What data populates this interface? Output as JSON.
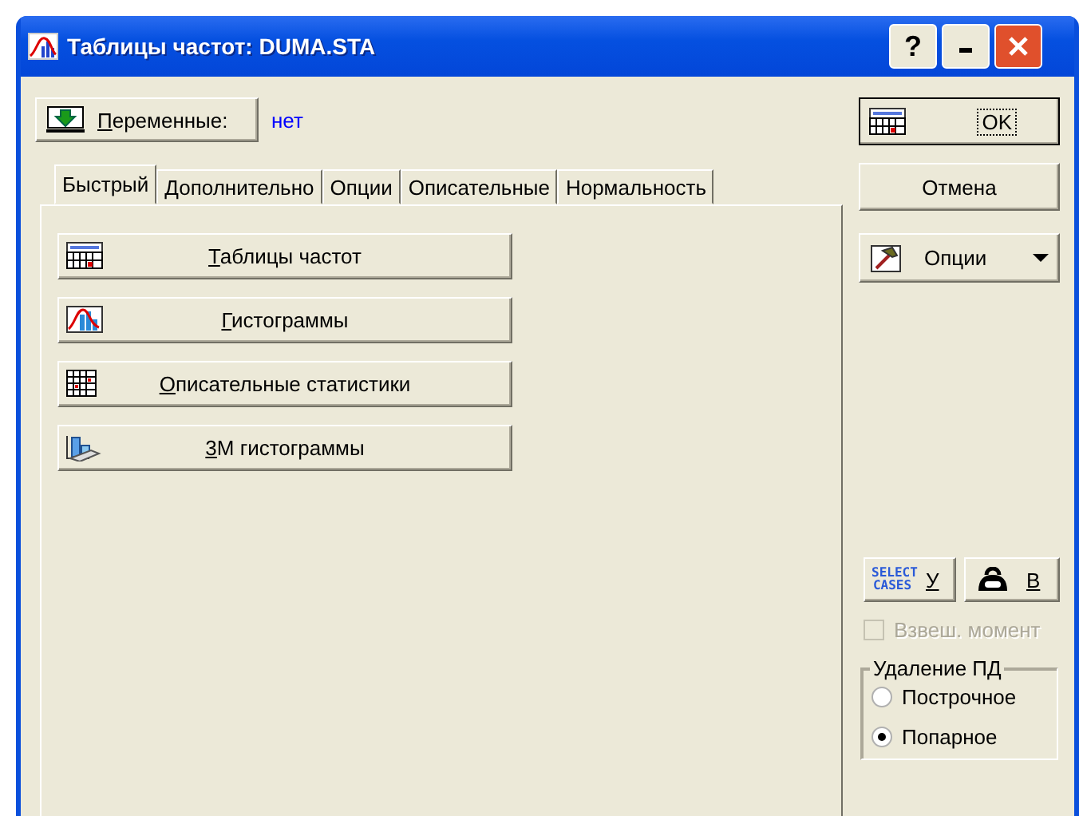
{
  "window": {
    "title": "Таблицы частот: DUMA.STA",
    "help_button": "?"
  },
  "variables": {
    "button": "Переменные:",
    "value": "нет"
  },
  "tabs": [
    {
      "label": "Быстрый",
      "selected": true
    },
    {
      "label": "Дополнительно",
      "selected": false
    },
    {
      "label": "Опции",
      "selected": false
    },
    {
      "label": "Описательные",
      "selected": false
    },
    {
      "label": "Нормальность",
      "selected": false
    }
  ],
  "quick_buttons": [
    {
      "label": "Таблицы частот",
      "kind": "table"
    },
    {
      "label": "Гистограммы",
      "kind": "histogram"
    },
    {
      "label": "Описательные статистики",
      "kind": "grid"
    },
    {
      "label": "3М гистограммы",
      "kind": "histogram3d"
    }
  ],
  "ok_button": "OK",
  "cancel_button": "Отмена",
  "options_button": "Опции",
  "select_cases": {
    "icon_text": "SELECT CASES",
    "label": "У"
  },
  "weight_button": {
    "label": "В"
  },
  "weighted": {
    "label": "Взвеш. момент",
    "checked": false,
    "disabled": true
  },
  "missing_data": {
    "title": "Удаление ПД",
    "options": [
      {
        "label": "Построчное",
        "selected": false
      },
      {
        "label": "Попарное",
        "selected": true
      }
    ]
  }
}
